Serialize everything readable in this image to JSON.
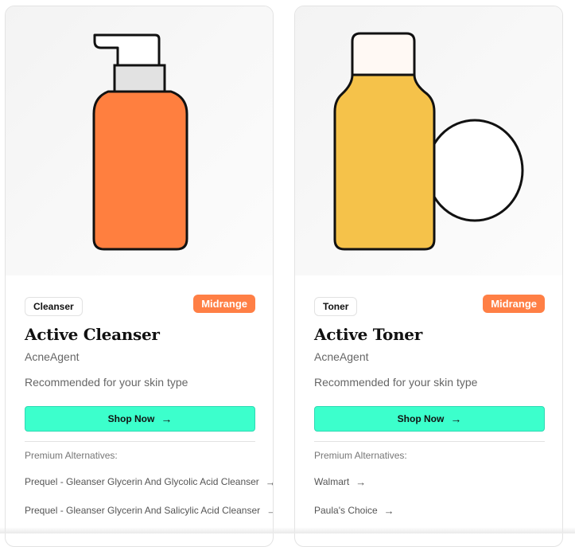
{
  "cards": [
    {
      "category": "Cleanser",
      "tier": "Midrange",
      "title": "Active Cleanser",
      "brand": "AcneAgent",
      "recommendation": "Recommended for your skin type",
      "shop_label": "Shop Now",
      "alternatives_heading": "Premium Alternatives:",
      "alternatives": [
        "Prequel - Gleanser Glycerin And Glycolic Acid Cleanser",
        "Prequel - Gleanser Glycerin And Salicylic Acid Cleanser"
      ],
      "illustration": "pump-bottle-icon",
      "product_color": "#ff7f3f"
    },
    {
      "category": "Toner",
      "tier": "Midrange",
      "title": "Active Toner",
      "brand": "AcneAgent",
      "recommendation": "Recommended for your skin type",
      "shop_label": "Shop Now",
      "alternatives_heading": "Premium Alternatives:",
      "alternatives": [
        "Walmart",
        "Paula's Choice"
      ],
      "illustration": "toner-bottle-with-cotton-pad-icon",
      "product_color": "#f5c24a"
    }
  ],
  "colors": {
    "tier_badge": "#ff7f45",
    "shop_button": "#3cffcc"
  }
}
